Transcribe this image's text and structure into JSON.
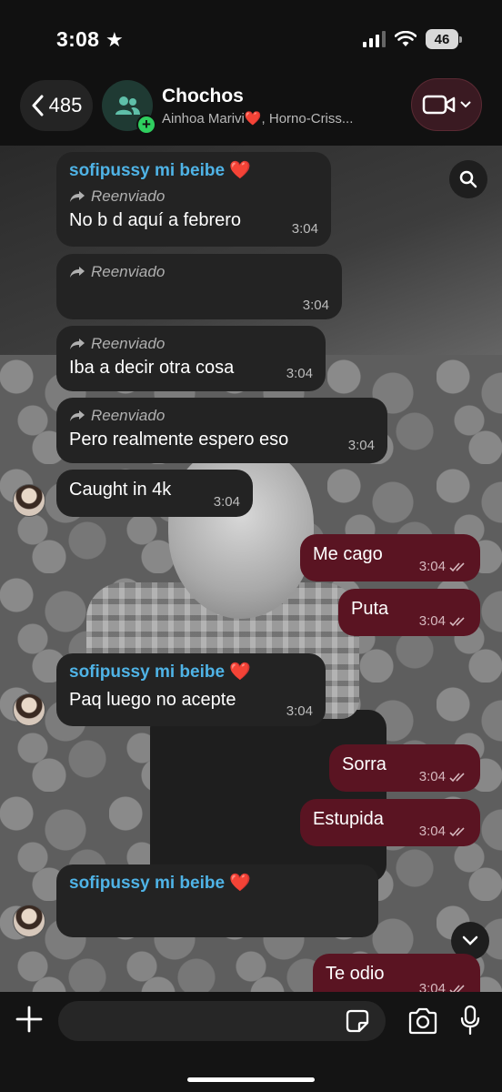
{
  "status": {
    "time": "3:08",
    "battery": "46"
  },
  "header": {
    "back_count": "485",
    "title": "Chochos",
    "members": "Ainhoa Marivi❤️, Horno-Criss..."
  },
  "messages": [
    {
      "sender": "sofipussy mi beibe ❤️",
      "forwarded": "Reenviado",
      "text": "No b d aquí a febrero",
      "time": "3:04"
    },
    {
      "forwarded": "Reenviado",
      "text": "",
      "time": "3:04"
    },
    {
      "forwarded": "Reenviado",
      "text": "Iba a decir otra cosa",
      "time": "3:04"
    },
    {
      "forwarded": "Reenviado",
      "text": "Pero realmente espero eso",
      "time": "3:04"
    },
    {
      "text": "Caught in 4k",
      "time": "3:04"
    },
    {
      "text": "Me cago",
      "time": "3:04"
    },
    {
      "text": "Puta",
      "time": "3:04"
    },
    {
      "sender": "sofipussy mi beibe ❤️",
      "text": "Paq luego no acepte",
      "time": "3:04"
    },
    {
      "text": "Sorra",
      "time": "3:04"
    },
    {
      "text": "Estupida",
      "time": "3:04"
    },
    {
      "sender": "sofipussy mi beibe ❤️",
      "text": "",
      "time": ""
    },
    {
      "text": "Te odio",
      "time": "3:04"
    }
  ],
  "input": {
    "placeholder": ""
  },
  "colors": {
    "incoming": "#232323",
    "outgoing": "#5a1422",
    "sender": "#4fb3e6",
    "accent": "#2fcf5f"
  }
}
